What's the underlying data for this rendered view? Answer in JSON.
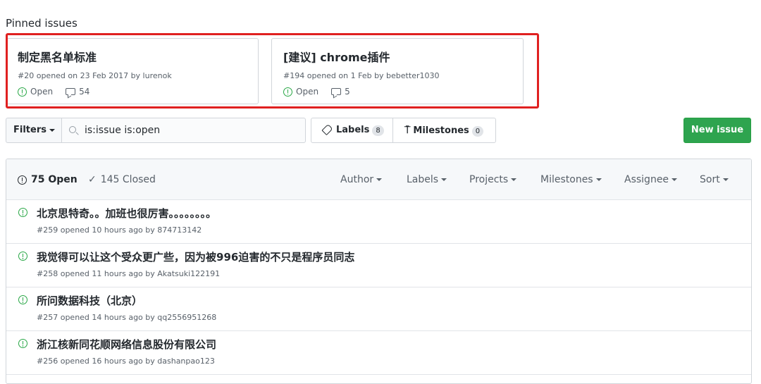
{
  "pinned": {
    "heading": "Pinned issues",
    "cards": [
      {
        "title": "制定黑名单标准",
        "meta": "#20 opened on 23 Feb 2017 by lurenok",
        "state": "Open",
        "comments": "54"
      },
      {
        "title": "[建议] chrome插件",
        "meta": "#194 opened on 1 Feb by bebetter1030",
        "state": "Open",
        "comments": "5"
      }
    ]
  },
  "toolbar": {
    "filters_label": "Filters",
    "search_value": "is:issue is:open",
    "labels_label": "Labels",
    "labels_count": "8",
    "milestones_label": "Milestones",
    "milestones_count": "0",
    "new_issue_label": "New issue"
  },
  "list_header": {
    "open_count": "75 Open",
    "closed_count": "145 Closed",
    "filters": [
      "Author",
      "Labels",
      "Projects",
      "Milestones",
      "Assignee",
      "Sort"
    ]
  },
  "issues": [
    {
      "title": "北京思特奇。。加班也很厉害。。。。。。。。",
      "meta": "#259 opened 10 hours ago by 874713142"
    },
    {
      "title": "我觉得可以让这个受众更广些，因为被996迫害的不只是程序员同志",
      "meta": "#258 opened 11 hours ago by Akatsuki122191"
    },
    {
      "title": "所问数据科技（北京）",
      "meta": "#257 opened 14 hours ago by qq2556951268"
    },
    {
      "title": "浙江核新同花顺网络信息股份有限公司",
      "meta": "#256 opened 16 hours ago by dashanpao123"
    }
  ],
  "colors": {
    "accent_green": "#28a745",
    "button_green": "#2ea44f",
    "highlight_red": "#e02020"
  }
}
